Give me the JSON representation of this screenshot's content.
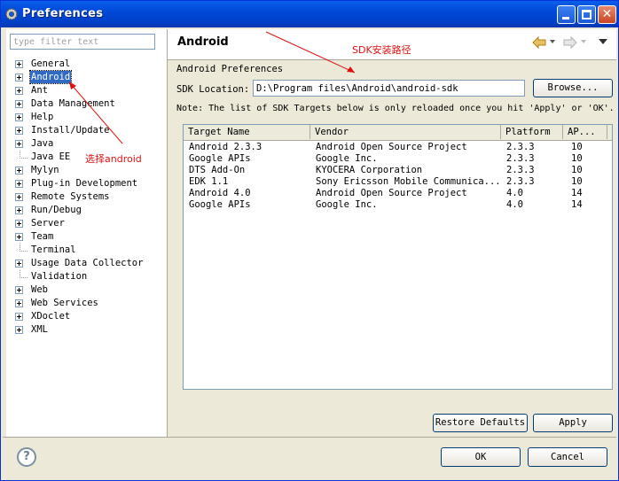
{
  "window": {
    "title": "Preferences"
  },
  "filter": {
    "placeholder": "type filter text"
  },
  "tree": [
    {
      "label": "General",
      "expandable": true
    },
    {
      "label": "Android",
      "expandable": true,
      "selected": true
    },
    {
      "label": "Ant",
      "expandable": true
    },
    {
      "label": "Data Management",
      "expandable": true
    },
    {
      "label": "Help",
      "expandable": true
    },
    {
      "label": "Install/Update",
      "expandable": true
    },
    {
      "label": "Java",
      "expandable": true
    },
    {
      "label": "Java EE",
      "expandable": false
    },
    {
      "label": "Mylyn",
      "expandable": true
    },
    {
      "label": "Plug-in Development",
      "expandable": true
    },
    {
      "label": "Remote Systems",
      "expandable": true
    },
    {
      "label": "Run/Debug",
      "expandable": true
    },
    {
      "label": "Server",
      "expandable": true
    },
    {
      "label": "Team",
      "expandable": true
    },
    {
      "label": "Terminal",
      "expandable": false
    },
    {
      "label": "Usage Data Collector",
      "expandable": true
    },
    {
      "label": "Validation",
      "expandable": false
    },
    {
      "label": "Web",
      "expandable": true
    },
    {
      "label": "Web Services",
      "expandable": true
    },
    {
      "label": "XDoclet",
      "expandable": true
    },
    {
      "label": "XML",
      "expandable": true
    }
  ],
  "page": {
    "title": "Android",
    "section_title": "Android Preferences",
    "sdk_label": "SDK Location:",
    "sdk_value": "D:\\Program files\\Android\\android-sdk",
    "browse_label": "Browse...",
    "note": "Note: The list of SDK Targets below is only reloaded once you hit 'Apply' or 'OK'."
  },
  "table": {
    "columns": [
      "Target Name",
      "Vendor",
      "Platform",
      "AP..."
    ],
    "rows": [
      [
        "Android 2.3.3",
        "Android Open Source Project",
        "2.3.3",
        "10"
      ],
      [
        "Google APIs",
        "Google Inc.",
        "2.3.3",
        "10"
      ],
      [
        "DTS Add-On",
        "KYOCERA Corporation",
        "2.3.3",
        "10"
      ],
      [
        "EDK 1.1",
        "Sony Ericsson Mobile Communica...",
        "2.3.3",
        "10"
      ],
      [
        "Android 4.0",
        "Android Open Source Project",
        "4.0",
        "14"
      ],
      [
        "Google APIs",
        "Google Inc.",
        "4.0",
        "14"
      ]
    ]
  },
  "buttons": {
    "restore_defaults": "Restore Defaults",
    "apply": "Apply",
    "ok": "OK",
    "cancel": "Cancel"
  },
  "annotations": {
    "sdk_path": "SDK安装路径",
    "select_android": "选择android"
  },
  "colors": {
    "accent": "#316ac5",
    "titlebar": "#0a5fe8",
    "annotation": "#e01010"
  }
}
